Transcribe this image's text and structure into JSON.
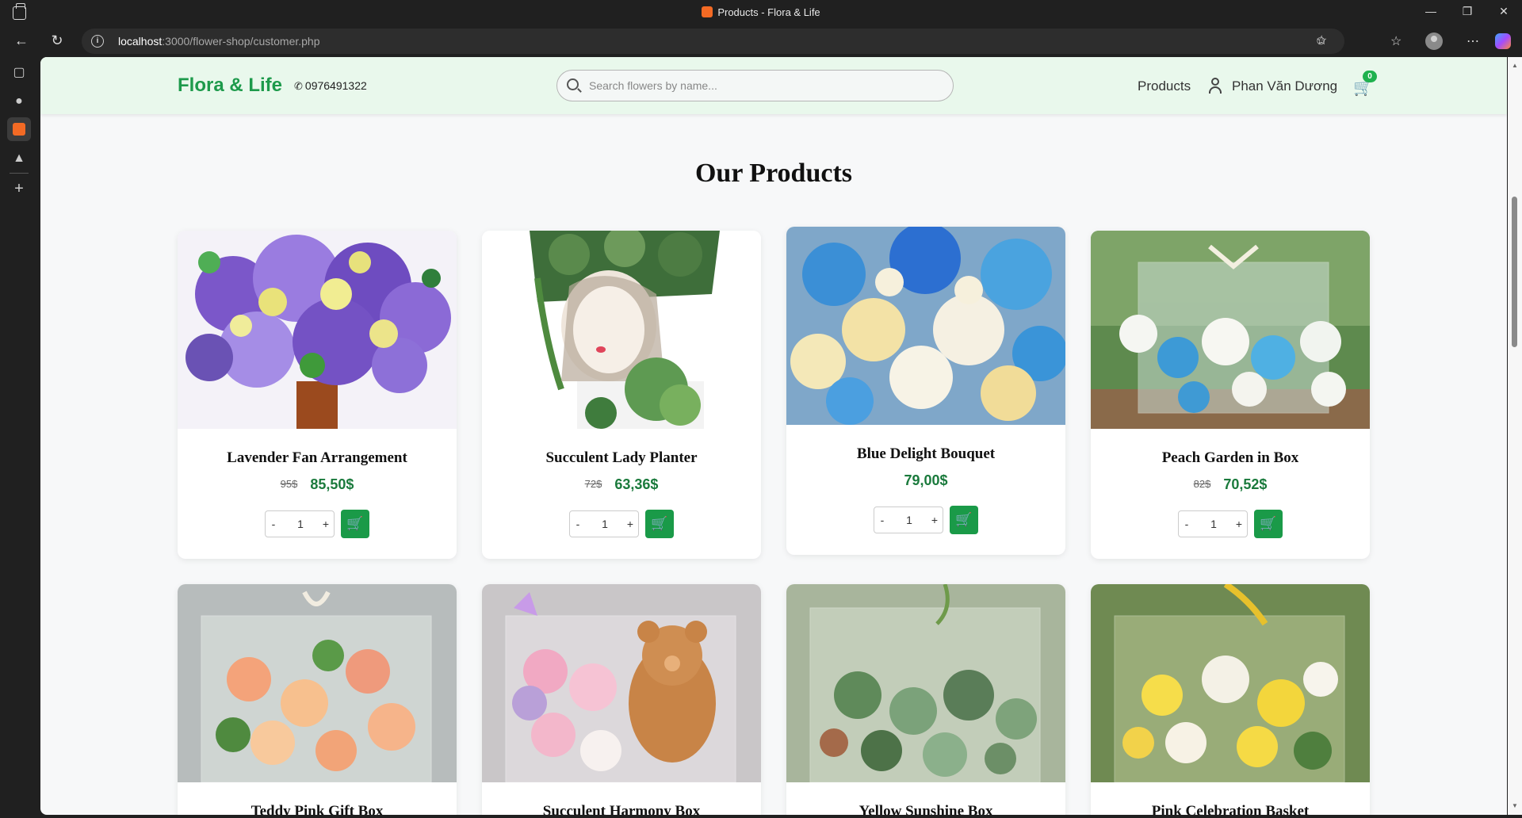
{
  "browser": {
    "tab_title": "Products - Flora & Life",
    "url_host": "localhost",
    "url_path": ":3000/flower-shop/customer.php"
  },
  "header": {
    "brand": "Flora & Life",
    "phone": "0976491322",
    "search_placeholder": "Search flowers by name...",
    "nav_products": "Products",
    "user_name": "Phan Văn Dương",
    "cart_count": "0"
  },
  "section_title": "Our Products",
  "products": [
    {
      "name": "Lavender Fan Arrangement",
      "old_price": "95$",
      "price": "85,50$",
      "qty": "1"
    },
    {
      "name": "Succulent Lady Planter",
      "old_price": "72$",
      "price": "63,36$",
      "qty": "1"
    },
    {
      "name": "Blue Delight Bouquet",
      "old_price": "",
      "price": "79,00$",
      "qty": "1"
    },
    {
      "name": "Peach Garden in Box",
      "old_price": "82$",
      "price": "70,52$",
      "qty": "1"
    },
    {
      "name": "Teddy Pink Gift Box"
    },
    {
      "name": "Succulent Harmony Box"
    },
    {
      "name": "Yellow Sunshine Box"
    },
    {
      "name": "Pink Celebration Basket"
    }
  ],
  "controls": {
    "minus": "-",
    "plus": "+"
  }
}
